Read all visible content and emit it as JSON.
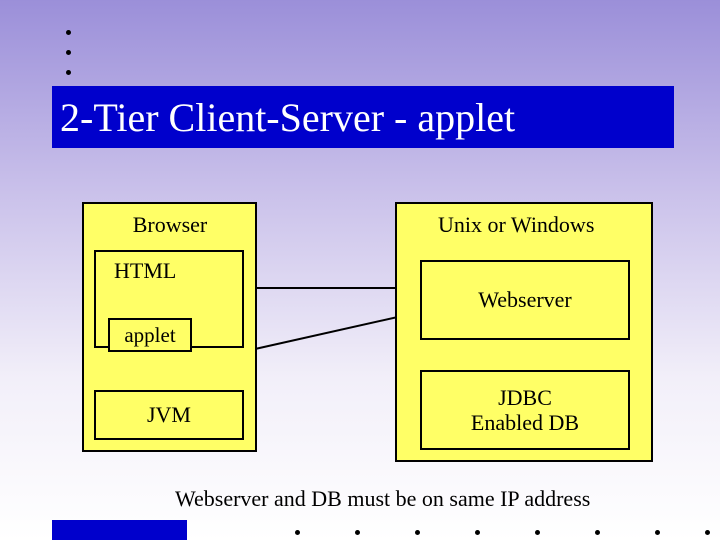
{
  "title": "2-Tier Client-Server - applet",
  "left_tier": {
    "header": "Browser",
    "html_box": "HTML",
    "applet_box": "applet",
    "jvm_box": "JVM"
  },
  "right_tier": {
    "header": "Unix or Windows",
    "webserver_box": "Webserver",
    "db_line1": "JDBC",
    "db_line2": "Enabled DB"
  },
  "caption": "Webserver and DB must be on same IP address"
}
